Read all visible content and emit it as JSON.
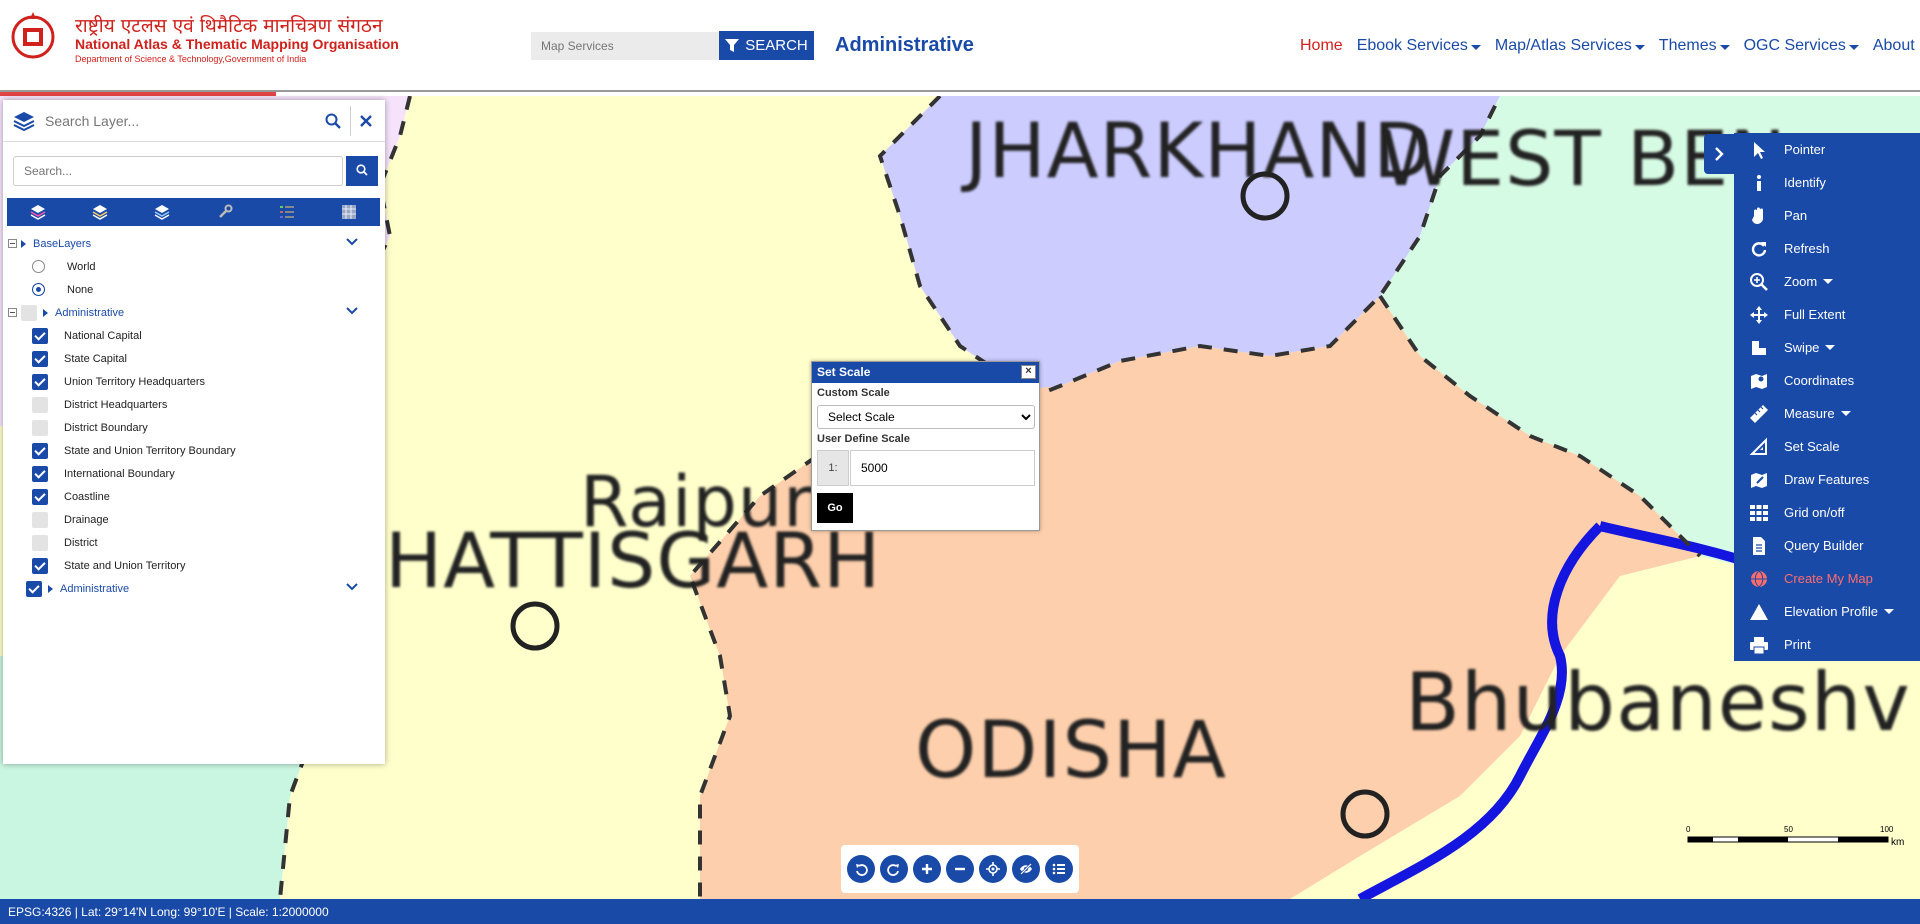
{
  "header": {
    "org_hindi": "राष्ट्रीय एटलस एवं थिमैटिक मानचित्रण संगठन",
    "org_english": "National Atlas & Thematic Mapping Organisation",
    "org_dept": "Department of Science & Technology,Government of India",
    "search_placeholder": "Map Services",
    "search_label": "SEARCH",
    "page_title": "Administrative",
    "nav": [
      "Home",
      "Ebook Services",
      "Map/Atlas Services",
      "Themes",
      "OGC Services",
      "About Us"
    ],
    "colors": {
      "brand_blue": "#1a4aa8",
      "brand_red": "#d0211c"
    }
  },
  "map": {
    "labels": [
      "JHARKHAND",
      "WEST BEN",
      "Raipur",
      "HATTISGARH",
      "ODISHA",
      "Bhubaneshv"
    ]
  },
  "layer_panel": {
    "search_placeholder": "Search Layer...",
    "filter_placeholder": "Search...",
    "tab_icons": [
      "layers-icon",
      "layers-icon",
      "layers-icon",
      "wrench-icon",
      "legend-icon",
      "grid-icon"
    ],
    "tree": {
      "base_group": "BaseLayers",
      "base_options": [
        {
          "label": "World",
          "selected": false
        },
        {
          "label": "None",
          "selected": true
        }
      ],
      "admin_group": "Administrative",
      "layers": [
        {
          "label": "National Capital",
          "checked": true
        },
        {
          "label": "State Capital",
          "checked": true
        },
        {
          "label": "Union Territory Headquarters",
          "checked": true
        },
        {
          "label": "District Headquarters",
          "checked": false
        },
        {
          "label": "District Boundary",
          "checked": false
        },
        {
          "label": "State and Union Territory Boundary",
          "checked": true
        },
        {
          "label": "International Boundary",
          "checked": true
        },
        {
          "label": "Coastline",
          "checked": true
        },
        {
          "label": "Drainage",
          "checked": false
        },
        {
          "label": "District",
          "checked": false
        },
        {
          "label": "State and Union Territory",
          "checked": true
        }
      ],
      "admin_group_2": "Administrative"
    }
  },
  "set_scale": {
    "title": "Set Scale",
    "custom_scale_label": "Custom Scale",
    "select_value": "Select Scale",
    "user_scale_label": "User Define Scale",
    "ratio_prefix": "1:",
    "ratio_value": "5000",
    "go_label": "Go"
  },
  "tools": [
    {
      "label": "Pointer",
      "icon": "pointer-icon"
    },
    {
      "label": "Identify",
      "icon": "info-icon"
    },
    {
      "label": "Pan",
      "icon": "hand-icon"
    },
    {
      "label": "Refresh",
      "icon": "refresh-icon"
    },
    {
      "label": "Zoom",
      "icon": "zoom-icon",
      "dropdown": true
    },
    {
      "label": "Full Extent",
      "icon": "move-icon"
    },
    {
      "label": "Swipe",
      "icon": "swipe-icon",
      "dropdown": true
    },
    {
      "label": "Coordinates",
      "icon": "map-marker-icon"
    },
    {
      "label": "Measure",
      "icon": "ruler-icon",
      "dropdown": true
    },
    {
      "label": "Set Scale",
      "icon": "set-square-icon"
    },
    {
      "label": "Draw Features",
      "icon": "map-pencil-icon"
    },
    {
      "label": "Grid on/off",
      "icon": "grid-icon"
    },
    {
      "label": "Query Builder",
      "icon": "document-icon"
    },
    {
      "label": "Create My Map",
      "icon": "globe-icon",
      "highlight": true
    },
    {
      "label": "Elevation Profile",
      "icon": "mountain-icon",
      "dropdown": true
    },
    {
      "label": "Print",
      "icon": "print-icon"
    }
  ],
  "map_controls": [
    "rotate-left-icon",
    "rotate-right-icon",
    "zoom-in-icon",
    "zoom-out-icon",
    "locate-icon",
    "hide-icon",
    "list-icon"
  ],
  "scale_bar": {
    "ticks": [
      "0",
      "50",
      "100"
    ],
    "unit": "km"
  },
  "status_bar": {
    "text": "EPSG:4326 | Lat: 29°14'N Long: 99°10'E | Scale: 1:2000000"
  }
}
